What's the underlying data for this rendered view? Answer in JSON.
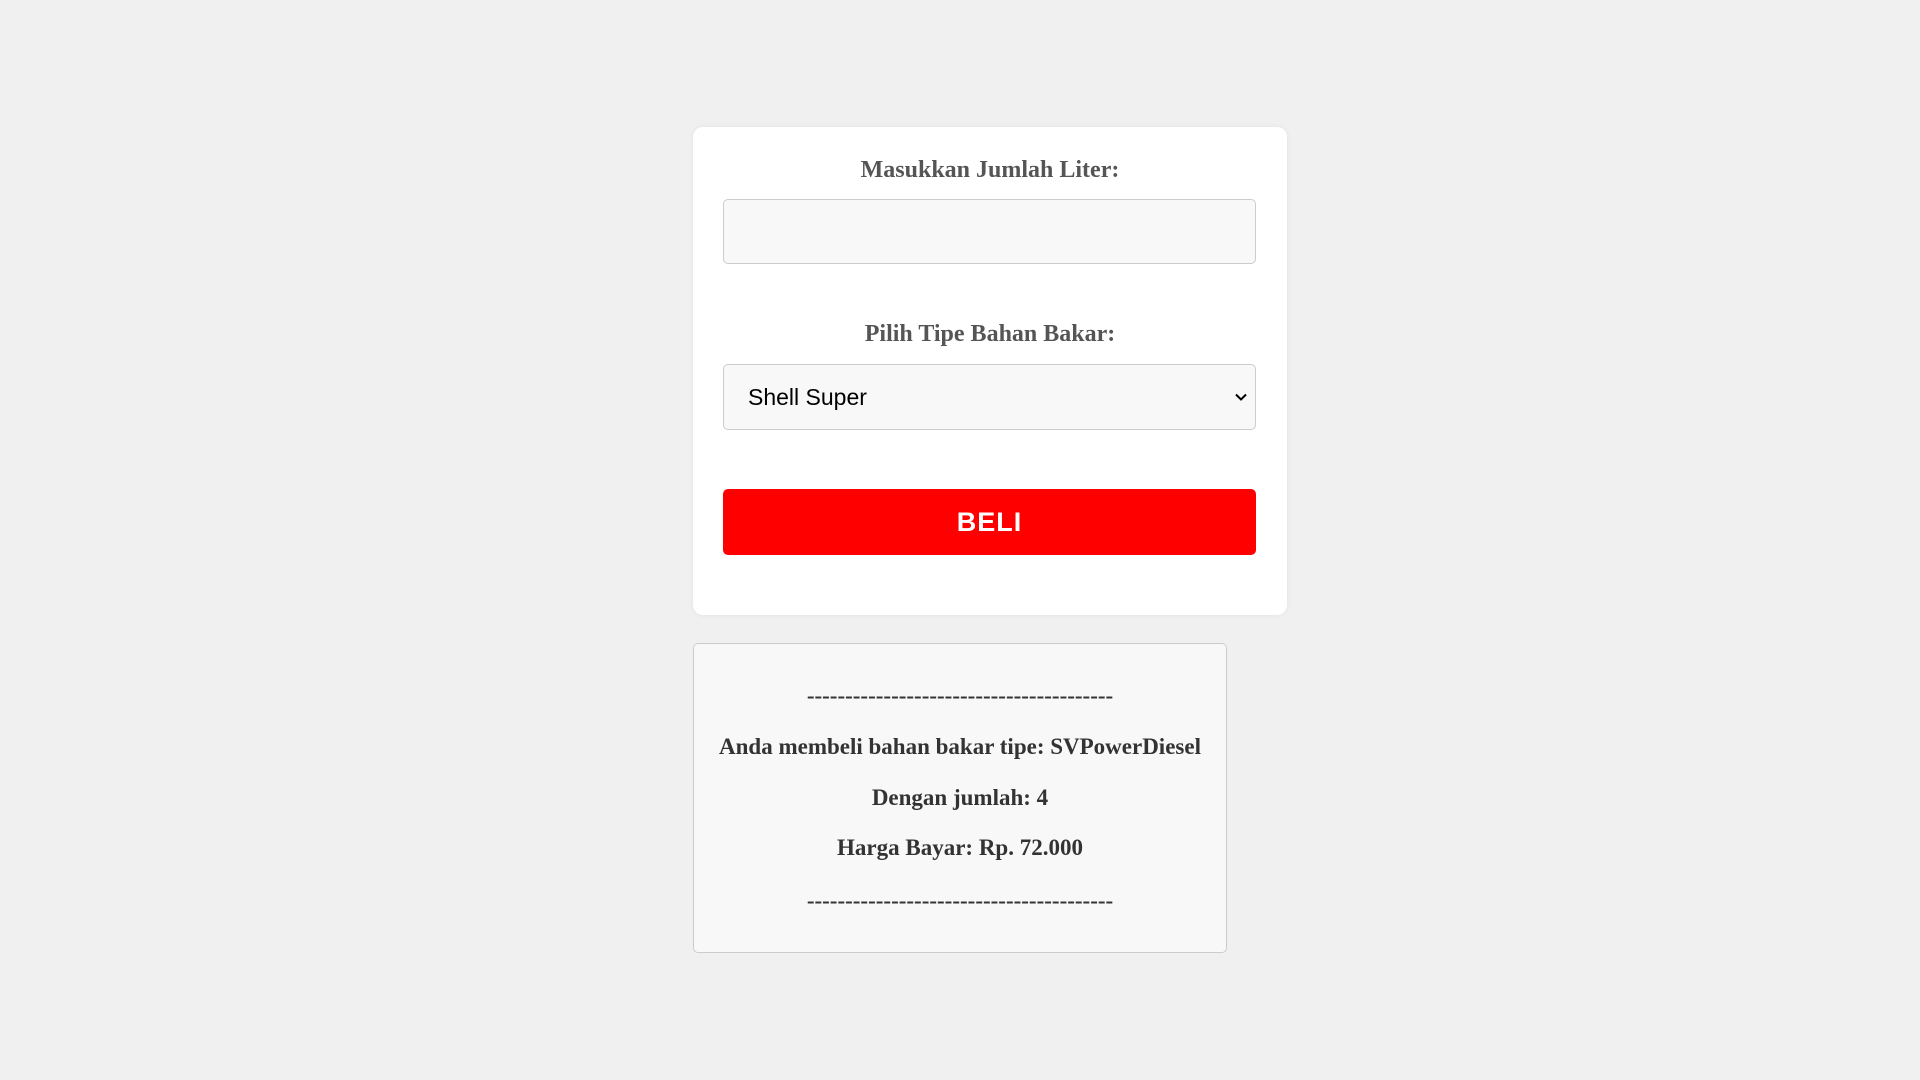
{
  "form": {
    "liter_label": "Masukkan Jumlah Liter:",
    "liter_value": "",
    "fuel_label": "Pilih Tipe Bahan Bakar:",
    "fuel_selected": "Shell Super",
    "buy_label": "BELI"
  },
  "result": {
    "separator_top": "----------------------------------------",
    "type_line": "Anda membeli bahan bakar tipe: SVPowerDiesel",
    "amount_line": "Dengan jumlah: 4",
    "price_line": "Harga Bayar: Rp. 72.000",
    "separator_bottom": "----------------------------------------"
  },
  "colors": {
    "button": "#ff0000",
    "background": "#f0f0f0"
  }
}
